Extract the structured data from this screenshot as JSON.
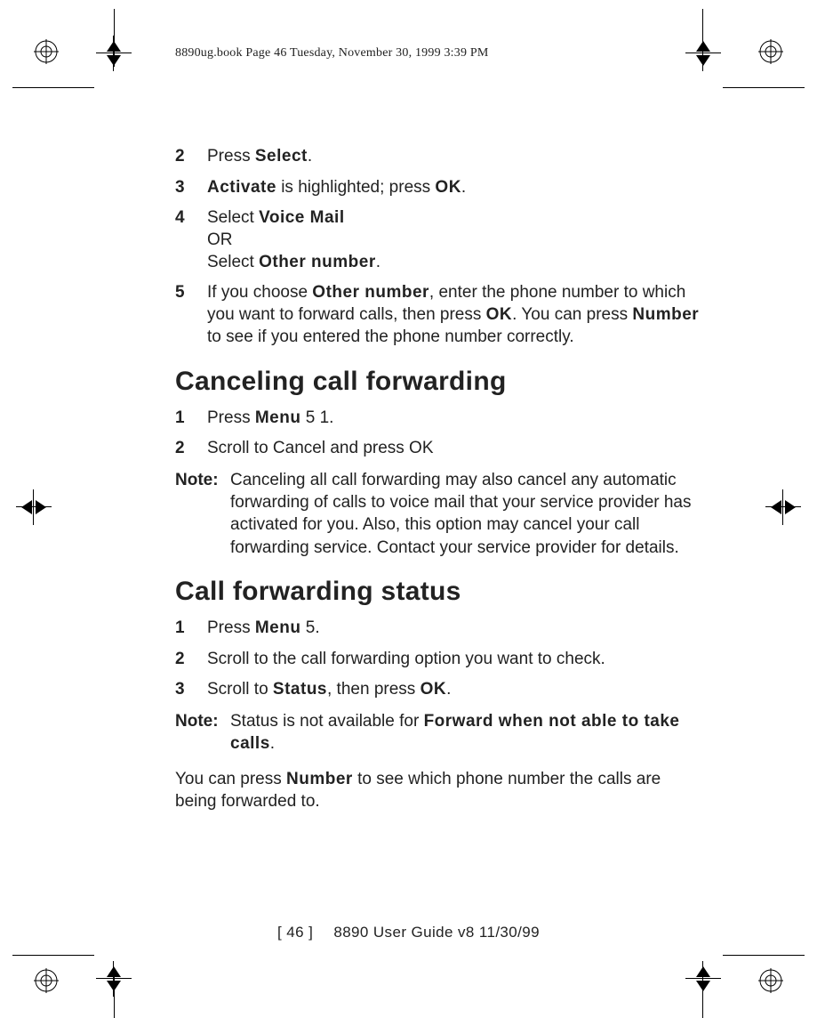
{
  "header": "8890ug.book  Page 46  Tuesday, November 30, 1999  3:39 PM",
  "stepsA": [
    {
      "n": "2",
      "pre": "Press ",
      "btn": "Select",
      "post": "."
    },
    {
      "n": "3",
      "pre": "",
      "btn": "Activate",
      "mid": " is highlighted; press ",
      "btn2": "OK",
      "post": "."
    },
    {
      "n": "4",
      "line1_pre": "Select ",
      "line1_btn": "Voice Mail",
      "line2": "OR",
      "line3_pre": "Select ",
      "line3_btn": "Other number",
      "line3_post": "."
    },
    {
      "n": "5",
      "pre": "If you choose ",
      "btn": "Other number",
      "mid": ", enter the phone number to which you want to forward calls, then press ",
      "btn2": "OK",
      "mid2": ". You can press ",
      "btn3": "Number",
      "post": " to see if you entered the phone number correctly."
    }
  ],
  "h2a": "Canceling call forwarding",
  "stepsB": [
    {
      "n": "1",
      "pre": "Press ",
      "btn": "Menu",
      "post": " 5 1."
    },
    {
      "n": "2",
      "text": "Scroll to Cancel and press OK"
    }
  ],
  "note1": {
    "label": "Note:",
    "body": "Canceling all call forwarding may also cancel any automatic forwarding of calls to voice mail that your service provider has activated for you. Also, this option may cancel your call forwarding service. Contact your service provider for details."
  },
  "h2b": "Call forwarding status",
  "stepsC": [
    {
      "n": "1",
      "pre": "Press ",
      "btn": "Menu",
      "post": " 5."
    },
    {
      "n": "2",
      "text": "Scroll to the call forwarding option you want to check."
    },
    {
      "n": "3",
      "pre": "Scroll to ",
      "btn": "Status",
      "mid": ", then press ",
      "btn2": "OK",
      "post": "."
    }
  ],
  "note2": {
    "label": "Note:",
    "pre": "Status is not available for ",
    "btn": "Forward when not able to take calls",
    "post": "."
  },
  "para": {
    "pre": "You can press ",
    "btn": "Number",
    "post": " to see which phone number the calls are being forwarded to."
  },
  "footer": {
    "pg": "[ 46 ]",
    "rest": "8890 User Guide v8   11/30/99"
  }
}
